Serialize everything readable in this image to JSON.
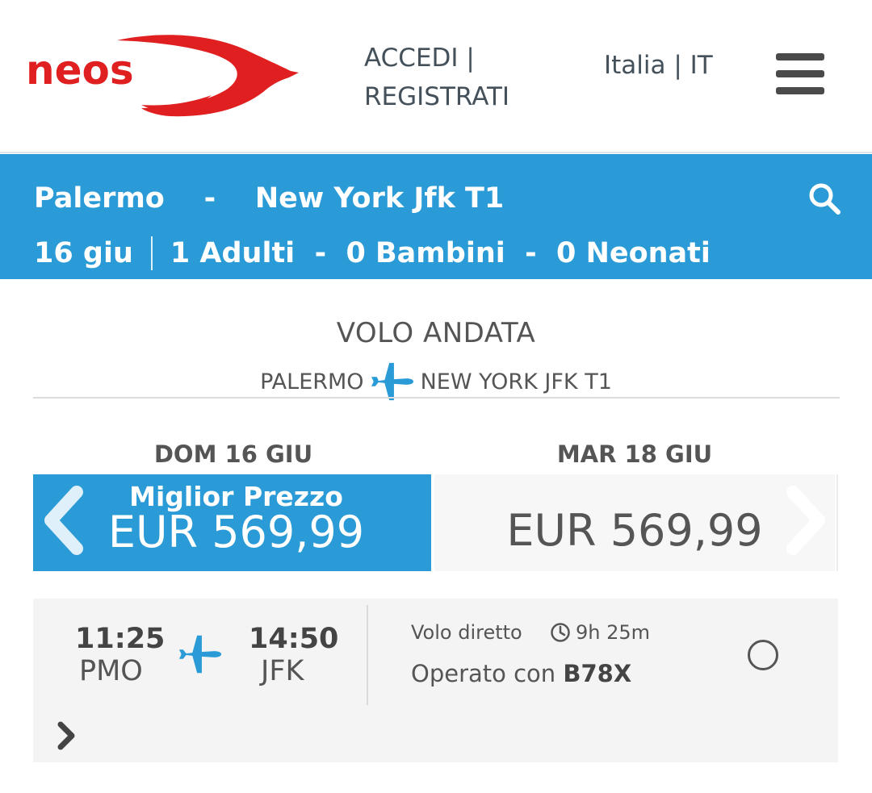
{
  "header": {
    "logo_text": "neos",
    "login_label": "ACCEDI |",
    "register_label": "REGISTRATI",
    "language_label": "Italia | IT"
  },
  "search": {
    "origin": "Palermo",
    "route_separator": "-",
    "destination": "New York Jfk T1",
    "date": "16 giu",
    "adults": "1 Adulti",
    "children": "0 Bambini",
    "infants": "0 Neonati",
    "pax_separator": "-"
  },
  "flight_section": {
    "title": "VOLO ANDATA",
    "origin": "PALERMO",
    "destination": "NEW YORK JFK T1"
  },
  "dates": [
    {
      "label": "DOM 16 GIU",
      "badge": "Miglior Prezzo",
      "price": "EUR 569,99",
      "selected": true
    },
    {
      "label": "MAR 18 GIU",
      "price": "EUR 569,99",
      "selected": false
    }
  ],
  "flight": {
    "dep_time": "11:25",
    "dep_code": "PMO",
    "arr_time": "14:50",
    "arr_code": "JFK",
    "type": "Volo diretto",
    "duration": "9h 25m",
    "operated_prefix": "Operato con",
    "aircraft": "B78X"
  },
  "colors": {
    "brand_red": "#e02020",
    "accent_blue": "#2a9bd6"
  },
  "icons": {
    "menu": "hamburger-icon",
    "search": "search-icon",
    "plane": "plane-icon",
    "clock": "clock-icon",
    "prev": "chevron-left-icon",
    "next": "chevron-right-icon",
    "expand": "chevron-right-icon"
  }
}
